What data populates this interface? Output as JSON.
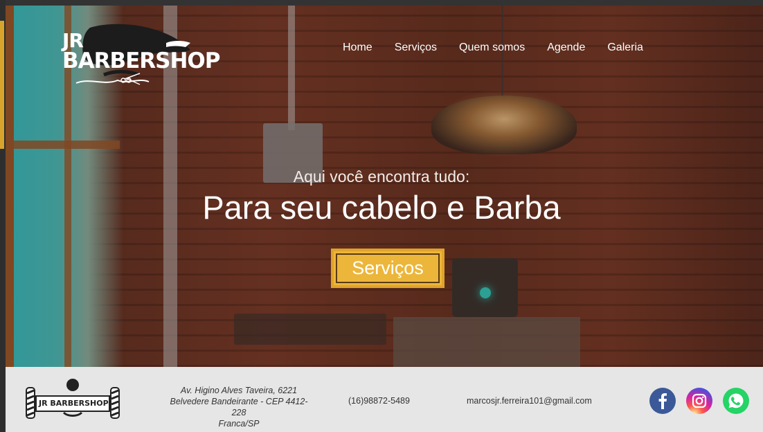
{
  "brand": {
    "logo_line1": "JR",
    "logo_line2": "BARBERSHOP",
    "footer_logo_text": "JR BARBERSHOP"
  },
  "nav": {
    "items": [
      {
        "label": "Home"
      },
      {
        "label": "Serviços"
      },
      {
        "label": "Quem somos"
      },
      {
        "label": "Agende"
      },
      {
        "label": "Galeria"
      }
    ]
  },
  "hero": {
    "subtitle": "Aqui você encontra tudo:",
    "title": "Para seu cabelo e Barba",
    "cta_label": "Serviços"
  },
  "footer": {
    "address_line1": "Av. Higino Alves Taveira, 6221",
    "address_line2": "Belvedere Bandeirante - CEP 4412-228",
    "address_line3": "Franca/SP",
    "phone": "(16)98872-5489",
    "email": "marcosjr.ferreira101@gmail.com",
    "social": [
      {
        "icon": "facebook-icon",
        "color": "#3b5998"
      },
      {
        "icon": "instagram-icon",
        "color": "#d6249f"
      },
      {
        "icon": "whatsapp-icon",
        "color": "#25d366"
      }
    ]
  },
  "colors": {
    "accent": "#ecb63b",
    "footer_bg": "#e6e6e6"
  }
}
